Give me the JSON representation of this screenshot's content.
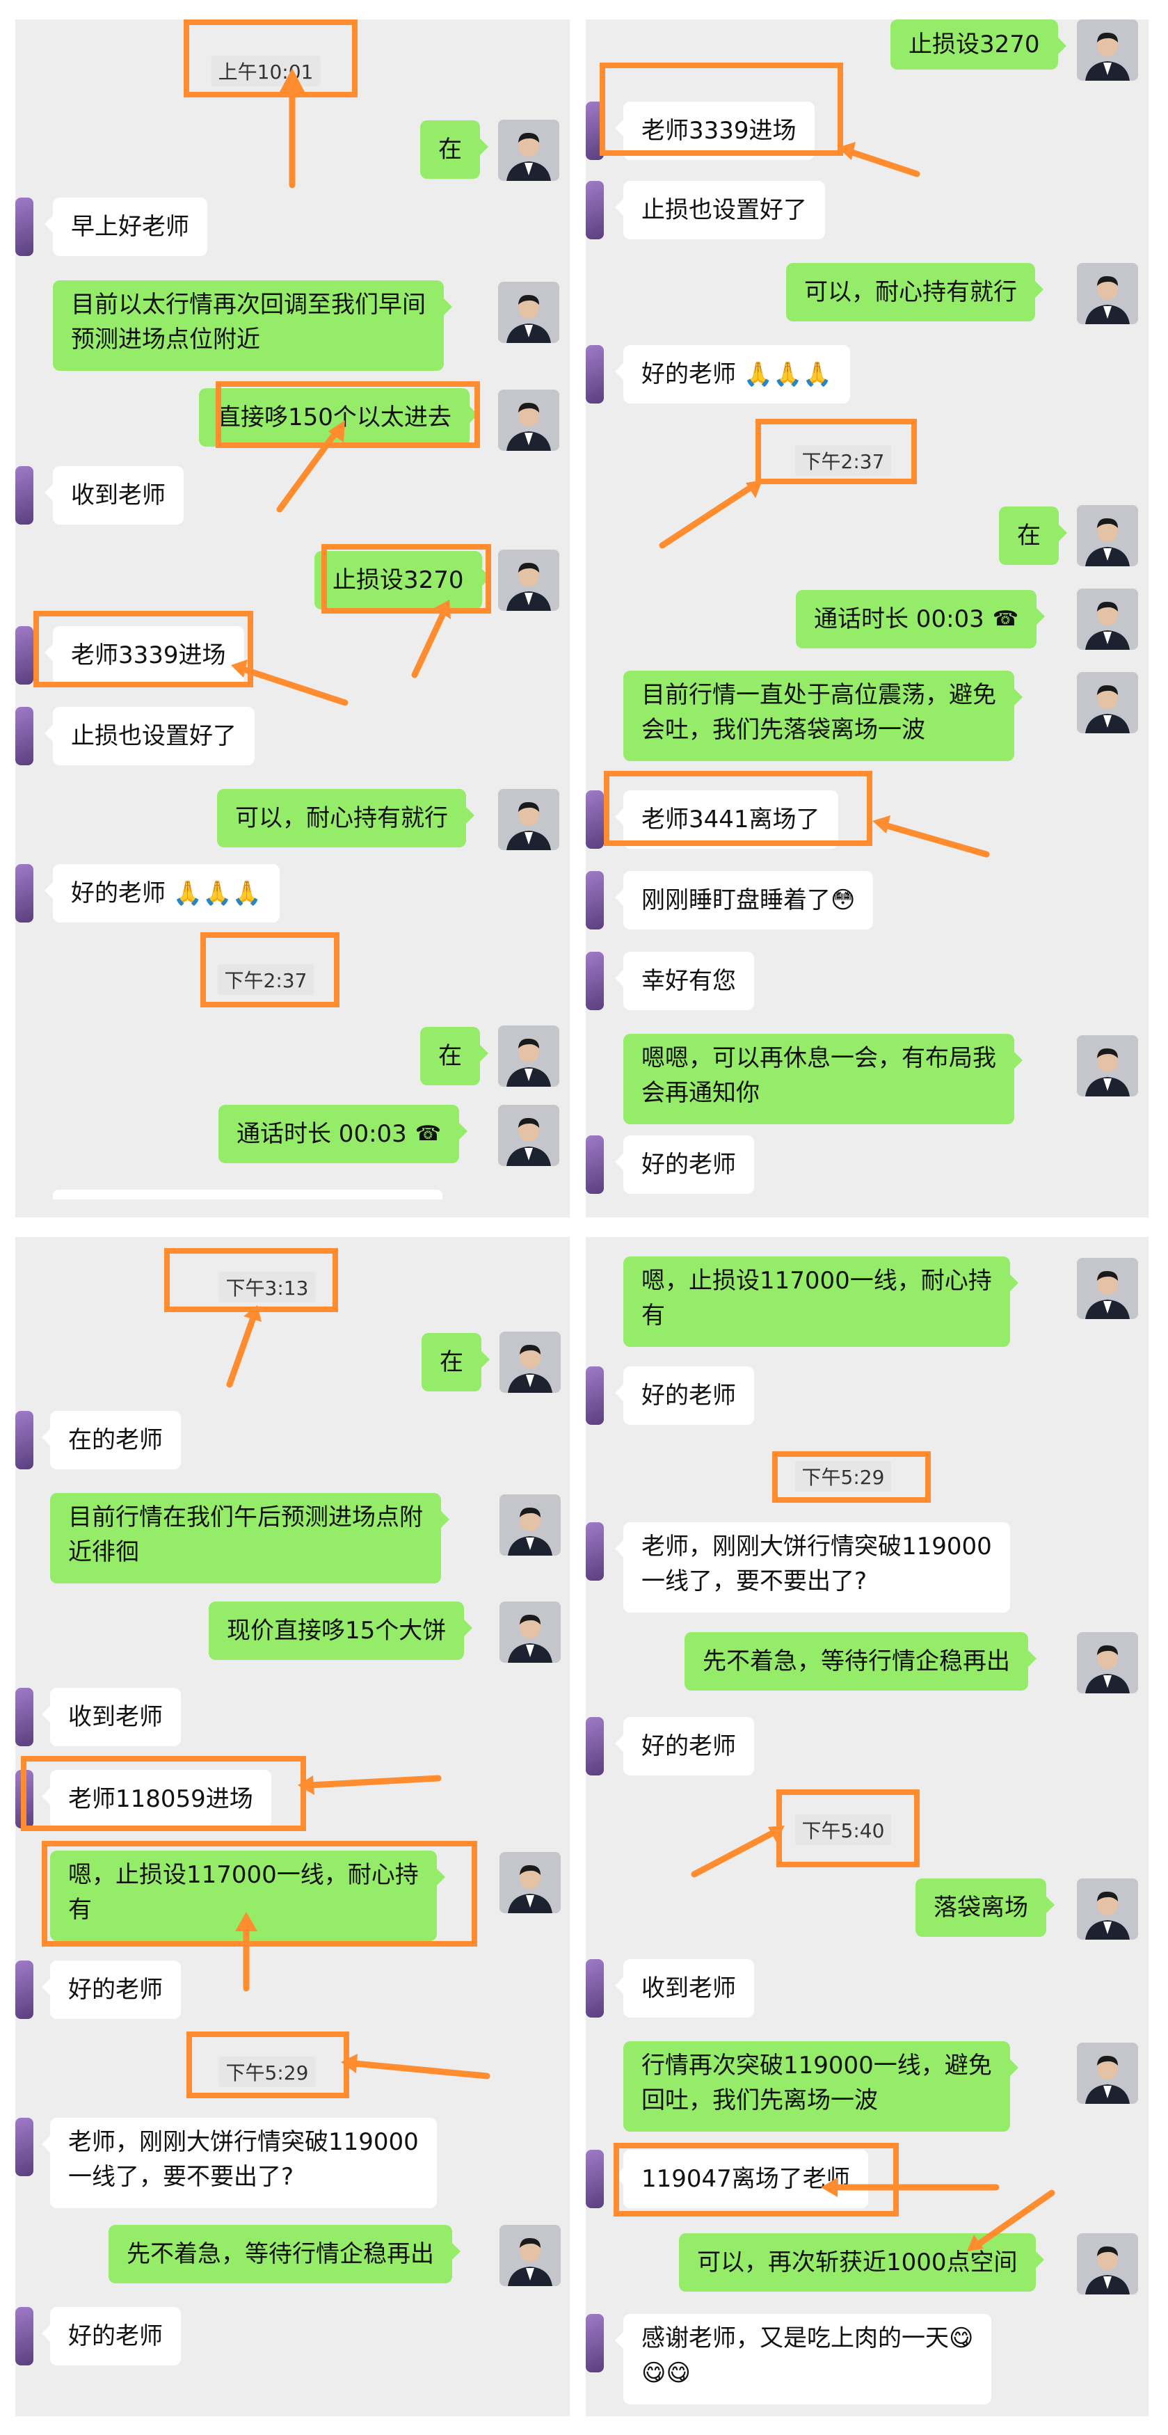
{
  "colors": {
    "chat_bg": "#ededed",
    "outgoing_bubble": "#95ec69",
    "incoming_bubble": "#ffffff",
    "annotation": "#ff8c2e"
  },
  "icons": {
    "call_icon": "phone-hangup-icon",
    "emoji_pray": "🙏",
    "emoji_flushed": "😳",
    "emoji_yum": "😋"
  },
  "panel1": {
    "ts1": "上午10:01",
    "m1": "在",
    "m2": "早上好老师",
    "m3a": "目前以太行情再次回调至我们早间",
    "m3b": "预测进场点位附近",
    "m4": "直接哆150个以太进去",
    "m5": "收到老师",
    "m6": "止损设3270",
    "m7": "老师3339进场",
    "m8": "止损也设置好了",
    "m9": "可以，耐心持有就行",
    "m10": "好的老师 🙏🙏🙏",
    "ts2": "下午2:37",
    "m11": "在",
    "m12": "通话时长 00:03"
  },
  "panel2": {
    "m1": "止损设3270",
    "m2": "老师3339进场",
    "m3": "止损也设置好了",
    "m4": "可以，耐心持有就行",
    "m5": "好的老师 🙏🙏🙏",
    "ts1": "下午2:37",
    "m6": "在",
    "m7": "通话时长 00:03",
    "m8a": "目前行情一直处于高位震荡，避免",
    "m8b": "会吐，我们先落袋离场一波",
    "m9": "老师3441离场了",
    "m10": "刚刚睡盯盘睡着了😳",
    "m11": "幸好有您",
    "m12a": "嗯嗯，可以再休息一会，有布局我",
    "m12b": "会再通知你",
    "m13": "好的老师"
  },
  "panel3": {
    "ts1": "下午3:13",
    "m1": "在",
    "m2": "在的老师",
    "m3a": "目前行情在我们午后预测进场点附",
    "m3b": "近徘徊",
    "m4": "现价直接哆15个大饼",
    "m5": "收到老师",
    "m6": "老师118059进场",
    "m7a": "嗯，止损设117000一线，耐心持",
    "m7b": "有",
    "m8": "好的老师",
    "ts2": "下午5:29",
    "m9a": "老师，刚刚大饼行情突破119000",
    "m9b": "一线了，要不要出了?",
    "m10": "先不着急，等待行情企稳再出",
    "m11": "好的老师"
  },
  "panel4": {
    "m1a": "嗯，止损设117000一线，耐心持",
    "m1b": "有",
    "m2": "好的老师",
    "ts1": "下午5:29",
    "m3a": "老师，刚刚大饼行情突破119000",
    "m3b": "一线了，要不要出了?",
    "m4": "先不着急，等待行情企稳再出",
    "m5": "好的老师",
    "ts2": "下午5:40",
    "m6": "落袋离场",
    "m7": "收到老师",
    "m8a": "行情再次突破119000一线，避免",
    "m8b": "回吐，我们先离场一波",
    "m9": "119047离场了老师",
    "m10": "可以，再次斩获近1000点空间",
    "m11a": "感谢老师，又是吃上肉的一天😋",
    "m11b": "😋😋"
  }
}
